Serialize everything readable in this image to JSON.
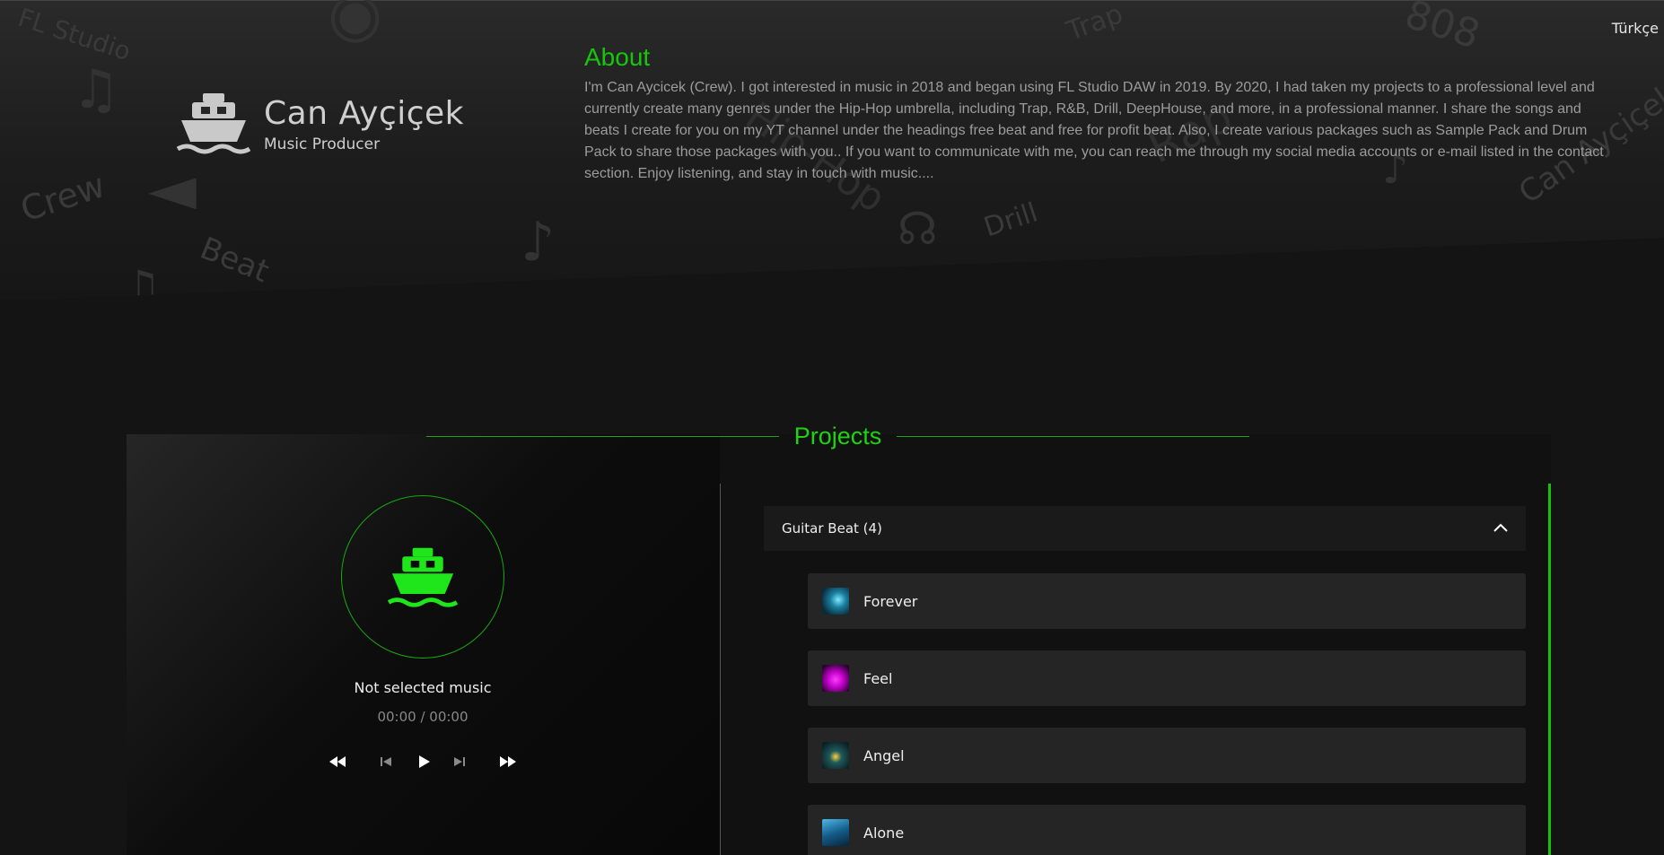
{
  "header": {
    "language_label": "Türkçe",
    "brand_name": "Can Ayçiçek",
    "brand_role": "Music Producer"
  },
  "background_words": [
    "FL Studio",
    "Crew",
    "Beat",
    "Trap",
    "808",
    "Hip-Hop",
    "Drill",
    "Rap",
    "Can Ayçiçek"
  ],
  "about": {
    "title": "About",
    "text": "I'm Can Aycicek (Crew). I got interested in music in 2018 and began using FL Studio DAW in 2019. By 2020, I had taken my projects to a professional level and currently create many genres under the Hip-Hop umbrella, including Trap, R&B, Drill, DeepHouse, and more, in a professional manner. I share the songs and beats I create for you on my YT channel under the headings free beat and free for profit beat. Also, I create various packages such as Sample Pack and Drum Pack to share those packages with you.. If you want to communicate with me, you can reach me through my social media accounts or e-mail listed in the contact section. Enjoy listening, and stay in touch with music...."
  },
  "projects": {
    "title": "Projects",
    "player": {
      "now_playing": "Not selected music",
      "time": "00:00 / 00:00",
      "controls": [
        "fast-rewind-icon",
        "skip-previous-icon",
        "play-icon",
        "skip-next-icon",
        "fast-forward-icon"
      ]
    },
    "category": {
      "label": "Guitar Beat (4)",
      "expanded": true
    },
    "tracks": [
      {
        "name": "Forever"
      },
      {
        "name": "Feel"
      },
      {
        "name": "Angel"
      },
      {
        "name": "Alone"
      }
    ]
  },
  "colors": {
    "accent": "#16c60c",
    "icon_green": "#1fe61a",
    "text_muted": "#9c9c9c"
  }
}
